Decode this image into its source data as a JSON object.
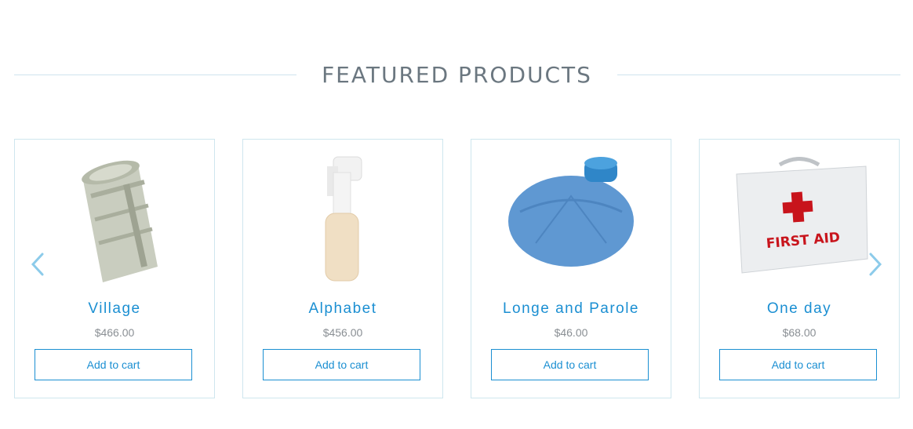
{
  "section": {
    "title": "FEATURED PRODUCTS"
  },
  "products": [
    {
      "name": "Village",
      "price": "$466.00",
      "cta": "Add to cart",
      "icon": "bandage-roll-icon"
    },
    {
      "name": "Alphabet",
      "price": "$456.00",
      "cta": "Add to cart",
      "icon": "inhaler-icon"
    },
    {
      "name": "Longe and Parole",
      "price": "$46.00",
      "cta": "Add to cart",
      "icon": "ice-bag-icon"
    },
    {
      "name": "One day",
      "price": "$68.00",
      "cta": "Add to cart",
      "icon": "first-aid-kit-icon",
      "label": "FIRST AID"
    }
  ],
  "carousel": {
    "prev_icon": "chevron-left-icon",
    "next_icon": "chevron-right-icon"
  },
  "colors": {
    "accent": "#1b8fd2",
    "title": "#6b7780",
    "price": "#8a8f94",
    "border": "#cfe6ee",
    "arrow": "#8ccbea"
  }
}
